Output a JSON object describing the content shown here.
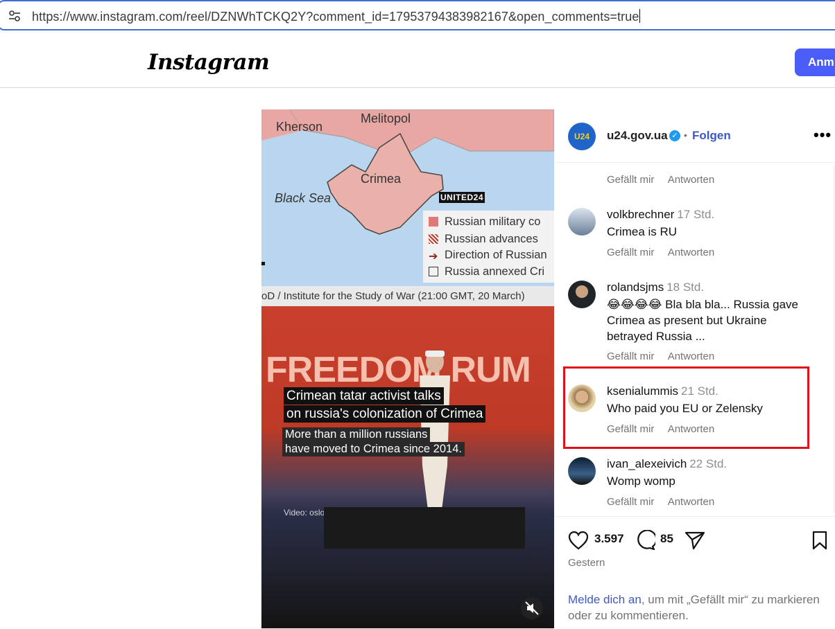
{
  "browser": {
    "url": "https://www.instagram.com/reel/DZNWhTCKQ2Y?comment_id=17953794383982167&open_comments=true",
    "site_info_icon": "tune-icon"
  },
  "header": {
    "logo": "Instagram",
    "login_label": "Anm"
  },
  "video": {
    "map_labels": {
      "kherson": "Kherson",
      "melitopol": "Melitopol",
      "crimea": "Crimea",
      "black_sea": "Black Sea",
      "badge": "UNITED24"
    },
    "legend": [
      {
        "label": "Russian military co",
        "color": "#e07a7a"
      },
      {
        "label": "Russian advances",
        "color": "#c0392b"
      },
      {
        "label": "Direction of Russian",
        "color": "#8e1f1f"
      },
      {
        "label": "Russia annexed Cri",
        "color": "#ffffff"
      }
    ],
    "map_source": "oD / Institute for the Study of War (21:00 GMT, 20 March)",
    "stage_banner": "FREEDOM  RUM",
    "caption_line1": "Crimean tatar activist talks",
    "caption_line2": "on russia's colonization of Crimea",
    "subcaption_line1": "More than a million russians",
    "subcaption_line2": "have moved to Crimea since 2014.",
    "credit": "Video: osloff/Instagram",
    "mute_icon": "speaker-muted-icon"
  },
  "post": {
    "avatar_text": "U24",
    "username": "u24.gov.ua",
    "verified_icon": "verified-badge-icon",
    "separator": "•",
    "follow_label": "Folgen",
    "more_icon": "more-options-icon"
  },
  "comments": {
    "top_actions": {
      "like": "Gefällt mir",
      "reply": "Antworten"
    },
    "items": [
      {
        "username": "volkbrechner",
        "time": "17 Std.",
        "text": "Crimea is RU",
        "like": "Gefällt mir",
        "reply": "Antworten",
        "avatar_color": "#7a8fa6"
      },
      {
        "username": "rolandsjms",
        "time": "18 Std.",
        "text": "😂😂😂😂 Bla bla bla... Russia gave Crimea as present but Ukraine betrayed Russia ...",
        "like": "Gefällt mir",
        "reply": "Antworten",
        "avatar_color": "#2a2622"
      },
      {
        "username": "ksenialummis",
        "time": "21 Std.",
        "text": "Who paid you EU or Zelensky",
        "like": "Gefällt mir",
        "reply": "Antworten",
        "avatar_color": "#c8a46a"
      },
      {
        "username": "ivan_alexeivich",
        "time": "22 Std.",
        "text": "Womp womp",
        "like": "Gefällt mir",
        "reply": "Antworten",
        "avatar_color": "#1f3a5c"
      }
    ]
  },
  "actions": {
    "like_icon": "heart-icon",
    "likes": "3.597",
    "comment_icon": "comment-icon",
    "comments": "85",
    "share_icon": "share-icon",
    "save_icon": "bookmark-icon",
    "date": "Gestern",
    "login_link": "Melde dich an",
    "login_rest": ", um mit „Gefällt mir“ zu markieren oder zu kommentieren."
  },
  "colors": {
    "accent": "#4a5df9",
    "link": "#3c59c8",
    "highlight": "#e0111b",
    "url_border": "#3b6fd0"
  }
}
